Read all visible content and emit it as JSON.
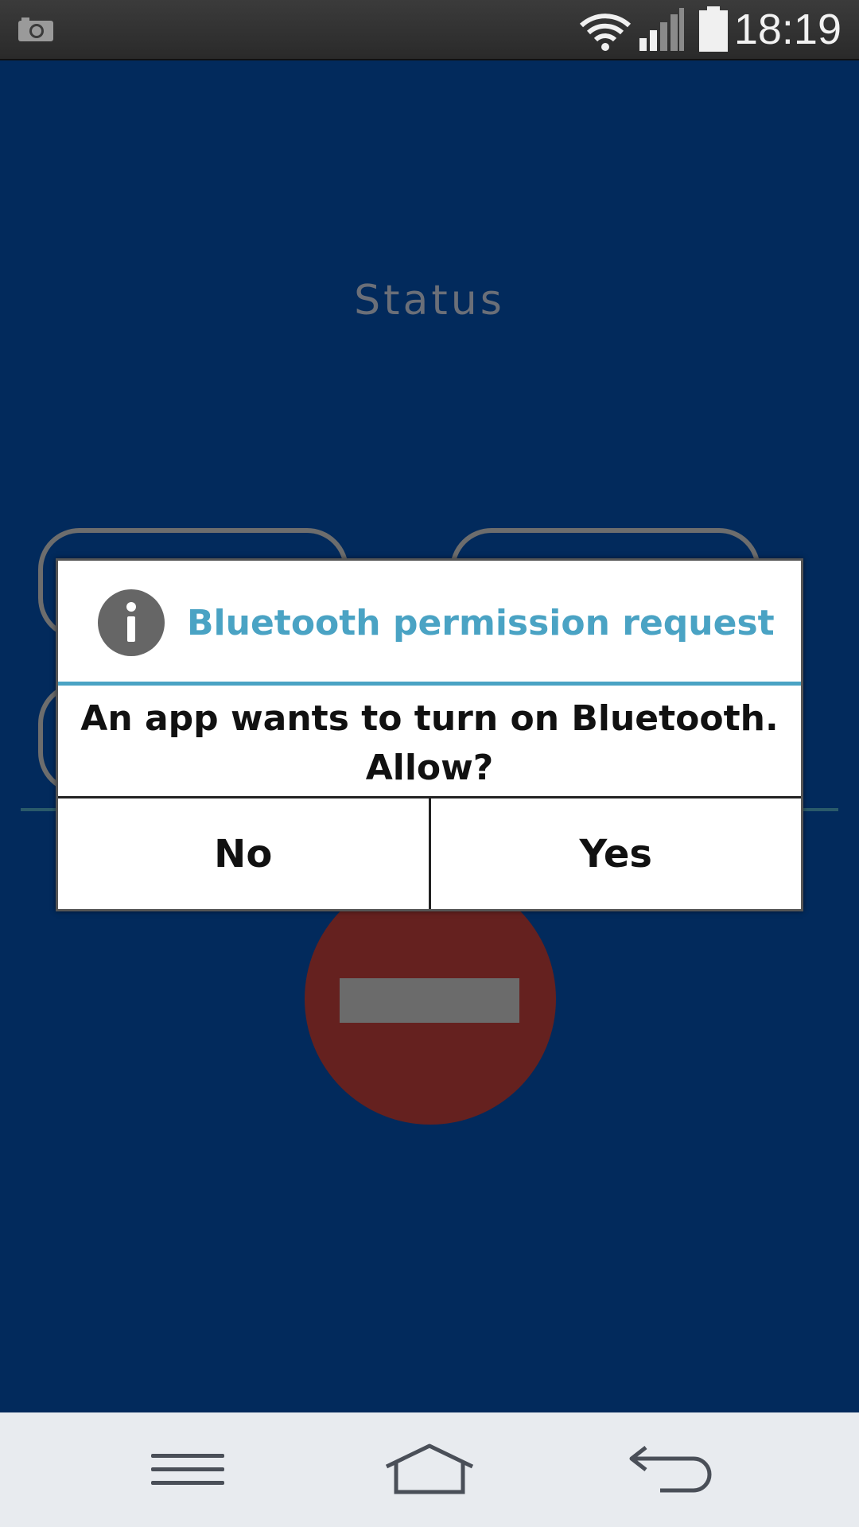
{
  "status_bar": {
    "time": "18:19",
    "icons": [
      "camera-icon",
      "wifi-icon",
      "signal-icon",
      "battery-icon"
    ]
  },
  "app": {
    "status_label": "Status"
  },
  "dialog": {
    "icon": "info-icon",
    "title": "Bluetooth permission request",
    "message": "An app wants to turn on Bluetooth. Allow?",
    "buttons": {
      "no": "No",
      "yes": "Yes"
    },
    "accent_color": "#4aa3c4"
  },
  "nav_bar": {
    "icons": [
      "menu-icon",
      "home-icon",
      "back-icon"
    ]
  },
  "colors": {
    "background": "#022a5c",
    "stop_button": "#65211f"
  }
}
